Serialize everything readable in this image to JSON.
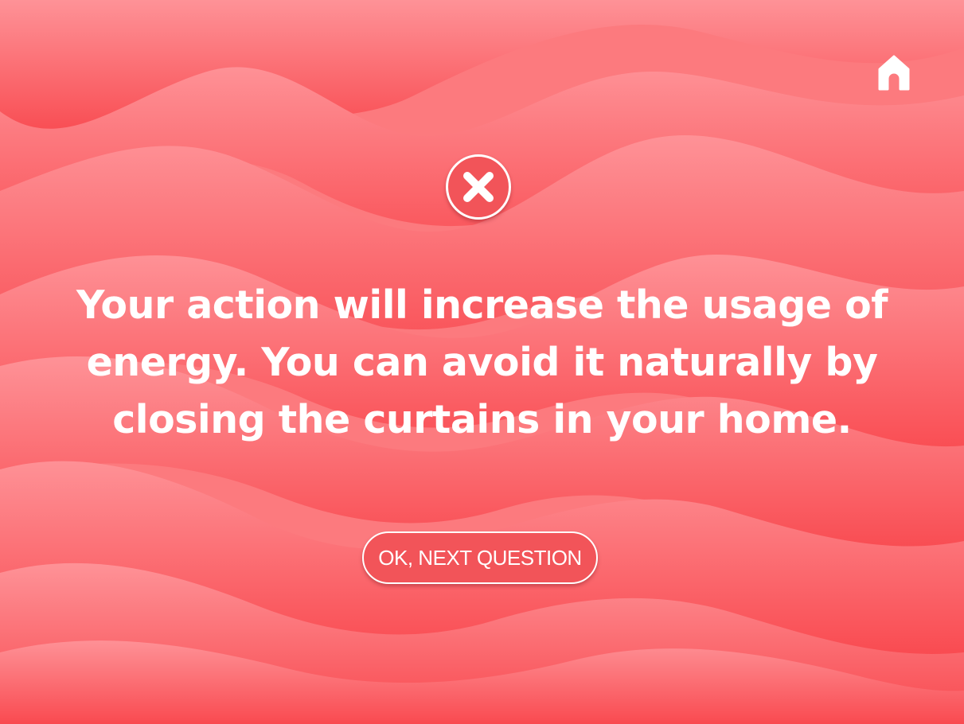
{
  "colors": {
    "background": "#fa6a6d",
    "wave_light": "#fe9095",
    "wave_dark": "#f9494f",
    "badge_fill": "#f25459",
    "button_fill": "#f25459",
    "text": "#ffffff"
  },
  "header": {
    "home_icon": "home-icon"
  },
  "feedback": {
    "status_icon": "close-x-icon",
    "message": "Your action will increase the usage of energy. You can avoid it naturally by closing the curtains in your home."
  },
  "actions": {
    "next_label": "OK, NEXT QUESTION"
  }
}
